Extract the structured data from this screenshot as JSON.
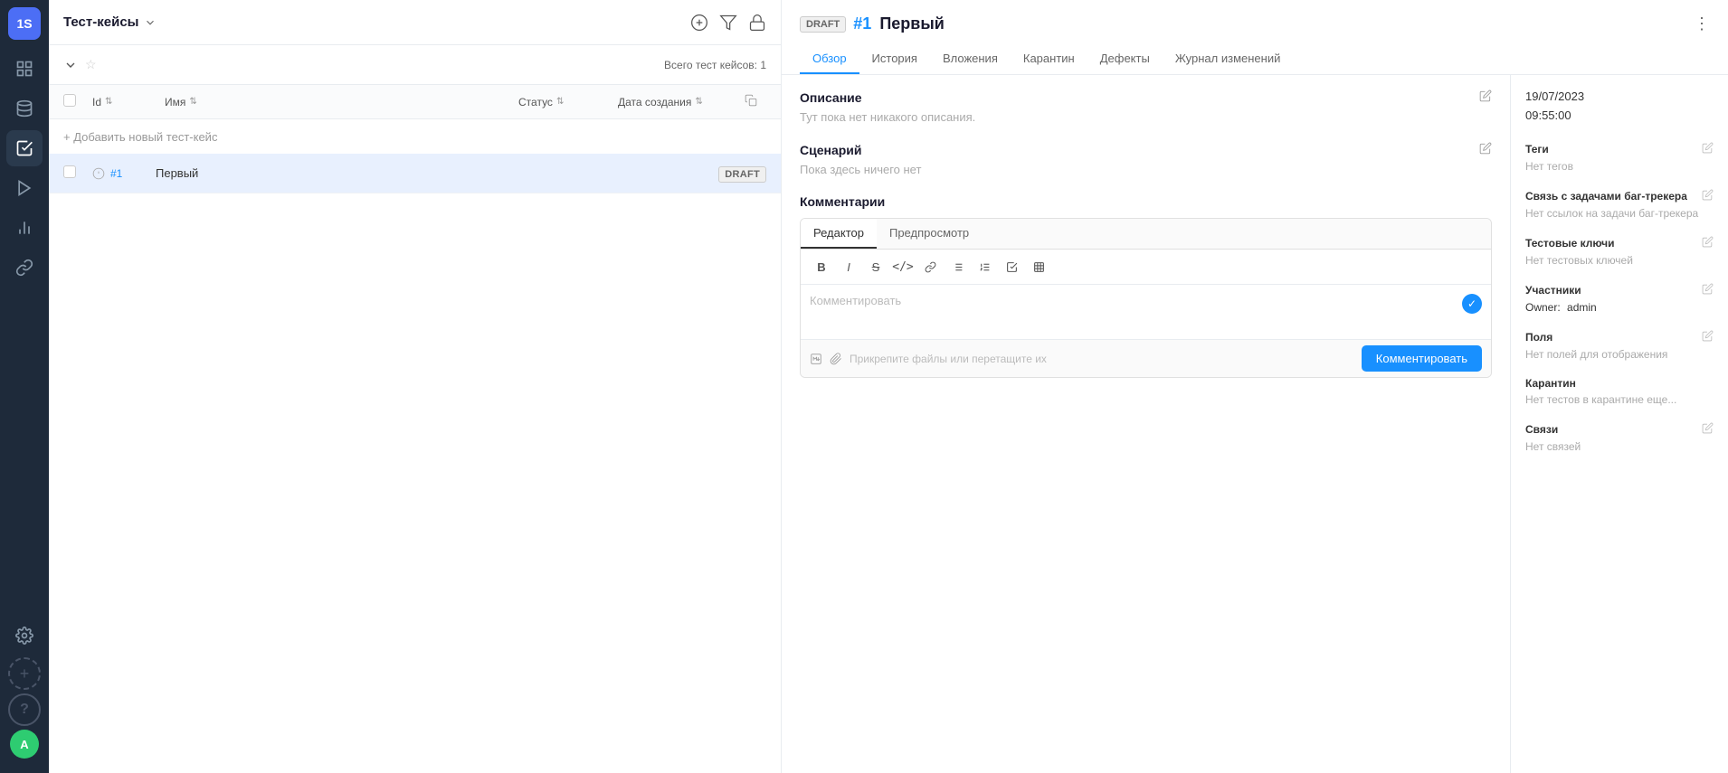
{
  "sidebar": {
    "logo": "1S",
    "avatar": "A",
    "items": [
      {
        "id": "dashboard",
        "icon": "grid"
      },
      {
        "id": "database",
        "icon": "database"
      },
      {
        "id": "testcases",
        "icon": "beaker",
        "active": true
      },
      {
        "id": "runs",
        "icon": "play-circle"
      },
      {
        "id": "reports",
        "icon": "chart-bar"
      },
      {
        "id": "integrations",
        "icon": "link"
      },
      {
        "id": "settings",
        "icon": "cog"
      }
    ],
    "add_label": "+",
    "help_label": "?"
  },
  "topbar": {
    "title": "Тест-кейсы",
    "chevron": "▾",
    "add_icon": "⊕",
    "filter_icon": "⊽",
    "lock_icon": "🔒"
  },
  "subtoolbar": {
    "collapse_icon": "▾",
    "star_icon": "☆",
    "count_label": "Всего тест кейсов: 1"
  },
  "table": {
    "columns": [
      {
        "id": "id",
        "label": "Id"
      },
      {
        "id": "name",
        "label": "Имя"
      },
      {
        "id": "status",
        "label": "Статус"
      },
      {
        "id": "date",
        "label": "Дата создания"
      }
    ],
    "add_row_label": "+ Добавить новый тест-кейс",
    "rows": [
      {
        "id": "#1",
        "name": "Первый",
        "status": "DRAFT"
      }
    ]
  },
  "detail": {
    "draft_tag": "DRAFT",
    "id": "#1",
    "title": "Первый",
    "menu_icon": "⋮",
    "tabs": [
      {
        "id": "overview",
        "label": "Обзор",
        "active": true
      },
      {
        "id": "history",
        "label": "История"
      },
      {
        "id": "attachments",
        "label": "Вложения"
      },
      {
        "id": "quarantine",
        "label": "Карантин"
      },
      {
        "id": "defects",
        "label": "Дефекты"
      },
      {
        "id": "changelog",
        "label": "Журнал изменений"
      }
    ],
    "description": {
      "label": "Описание",
      "placeholder": "Тут пока нет никакого описания."
    },
    "scenario": {
      "label": "Сценарий",
      "placeholder": "Пока здесь ничего нет"
    },
    "comments": {
      "label": "Комментарии",
      "editor_tab_editor": "Редактор",
      "editor_tab_preview": "Предпросмотр",
      "placeholder": "Комментировать",
      "attach_label": "Прикрепите файлы или перетащите их",
      "submit_label": "Комментировать"
    },
    "meta": {
      "date": "19/07/2023\n09:55:00",
      "tags_label": "Теги",
      "tags_value": "Нет тегов",
      "bugtracker_label": "Связь с задачами баг-трекера",
      "bugtracker_value": "Нет ссылок на задачи баг-трекера",
      "test_keys_label": "Тестовые ключи",
      "test_keys_value": "Нет тестовых ключей",
      "members_label": "Участники",
      "owner_label": "Owner:",
      "owner_value": "admin",
      "fields_label": "Поля",
      "fields_value": "Нет полей для отображения",
      "quarantine_label": "Карантин",
      "quarantine_value": "Нет тестов в карантине еще...",
      "links_label": "Связи",
      "links_value": "Нет связей"
    }
  }
}
